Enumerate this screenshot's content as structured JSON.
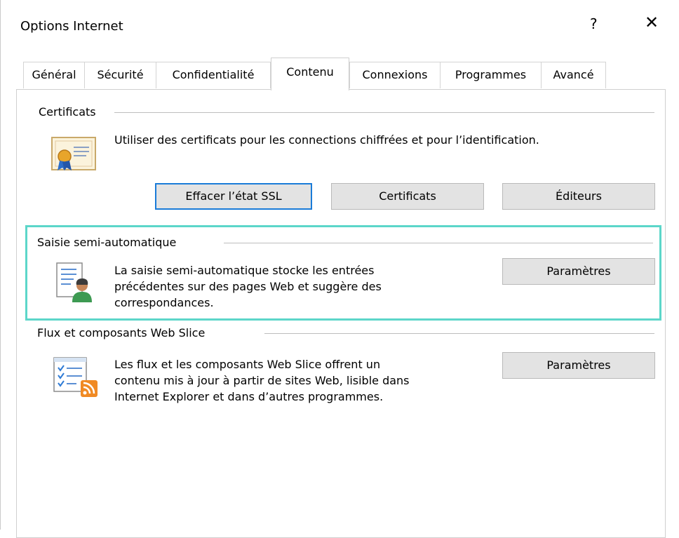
{
  "window": {
    "title": "Options Internet",
    "help_label": "?",
    "close_label": "✕"
  },
  "tabs": [
    {
      "label": "Général"
    },
    {
      "label": "Sécurité"
    },
    {
      "label": "Confidentialité"
    },
    {
      "label": "Contenu",
      "active": true
    },
    {
      "label": "Connexions"
    },
    {
      "label": "Programmes"
    },
    {
      "label": "Avancé"
    }
  ],
  "certificates": {
    "group_title": "Certificats",
    "description": "Utiliser des certificats pour les connections chiffrées et pour l’identification.",
    "icon": "certificate-icon",
    "buttons": {
      "clear_ssl": "Effacer l’état SSL",
      "certificates": "Certificats",
      "publishers": "Éditeurs"
    }
  },
  "autocomplete": {
    "group_title": "Saisie semi-automatique",
    "description_lines": [
      "La saisie semi-automatique stocke les entrées",
      "précédentes sur des pages Web et suggère des",
      "correspondances."
    ],
    "icon": "autocomplete-user-icon",
    "settings_button": "Paramètres",
    "highlight_color": "#5cd6c9"
  },
  "feeds": {
    "group_title": "Flux et composants Web Slice",
    "description_lines": [
      "Les flux et les composants Web Slice offrent un",
      "contenu mis à jour à partir de sites Web, lisible dans",
      "Internet Explorer et dans d’autres programmes."
    ],
    "icon": "feeds-rss-icon",
    "settings_button": "Paramètres"
  },
  "colors": {
    "default_button_border": "#1a7bd8",
    "button_bg": "#e3e3e3",
    "rss_orange": "#f08a24"
  }
}
